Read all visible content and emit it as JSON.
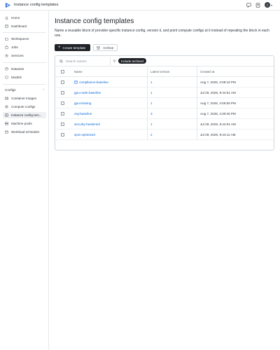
{
  "app": {
    "title": "Instance config templates"
  },
  "topbar": {
    "avatar_letter": "T"
  },
  "sidebar": {
    "group1": [
      {
        "label": "Home",
        "icon": "home-icon"
      },
      {
        "label": "Dashboard",
        "icon": "dashboard-icon"
      }
    ],
    "group2": [
      {
        "label": "Workspaces",
        "icon": "folder-icon"
      },
      {
        "label": "Jobs",
        "icon": "jobs-icon"
      },
      {
        "label": "Services",
        "icon": "services-icon"
      }
    ],
    "group3": [
      {
        "label": "Datasets",
        "icon": "dataset-icon"
      },
      {
        "label": "Models",
        "icon": "model-icon"
      }
    ],
    "configs_section": "Configs",
    "configs": [
      {
        "label": "Container images",
        "icon": "container-icon"
      },
      {
        "label": "Compute configs",
        "icon": "compute-icon"
      },
      {
        "label": "Instance config tem...",
        "icon": "template-icon",
        "active": true
      },
      {
        "label": "Machine pools",
        "icon": "machine-icon"
      },
      {
        "label": "Workload scheduler",
        "icon": "scheduler-icon"
      }
    ]
  },
  "page": {
    "title": "Instance config templates",
    "description": "Name a reusable block of provider-specific instance config, version it, and point compute configs at it instead of repeating the block in each one."
  },
  "actions": {
    "create_label": "Create template",
    "archive_label": "Archive"
  },
  "toolbar": {
    "search_placeholder": "Search names",
    "filter_pill": "Include archived"
  },
  "table": {
    "headers": {
      "name": "Name",
      "version": "Latest version",
      "created": "Created at"
    },
    "rows": [
      {
        "name": "compliance-baseline",
        "version": "1",
        "created": "Aug 7, 2026, 4:09:16 PM",
        "has_icon": true
      },
      {
        "name": "gpu-node-baseline",
        "version": "1",
        "created": "Jul 29, 2026, 9:44:01 AM"
      },
      {
        "name": "gpu-training",
        "version": "1",
        "created": "Aug 7, 2026, 4:06:55 PM"
      },
      {
        "name": "org-baseline",
        "version": "3",
        "created": "Aug 7, 2026, 4:30:25 PM"
      },
      {
        "name": "security-hardened",
        "version": "1",
        "created": "Jul 29, 2026, 9:44:01 AM"
      },
      {
        "name": "spot-optimized",
        "version": "2",
        "created": "Jul 29, 2026, 9:44:11 AM"
      }
    ]
  },
  "colors": {
    "accent": "#0969da",
    "primary_button": "#1f2328",
    "active_nav": "#eef0f3",
    "logo": "#2f6fe0"
  }
}
